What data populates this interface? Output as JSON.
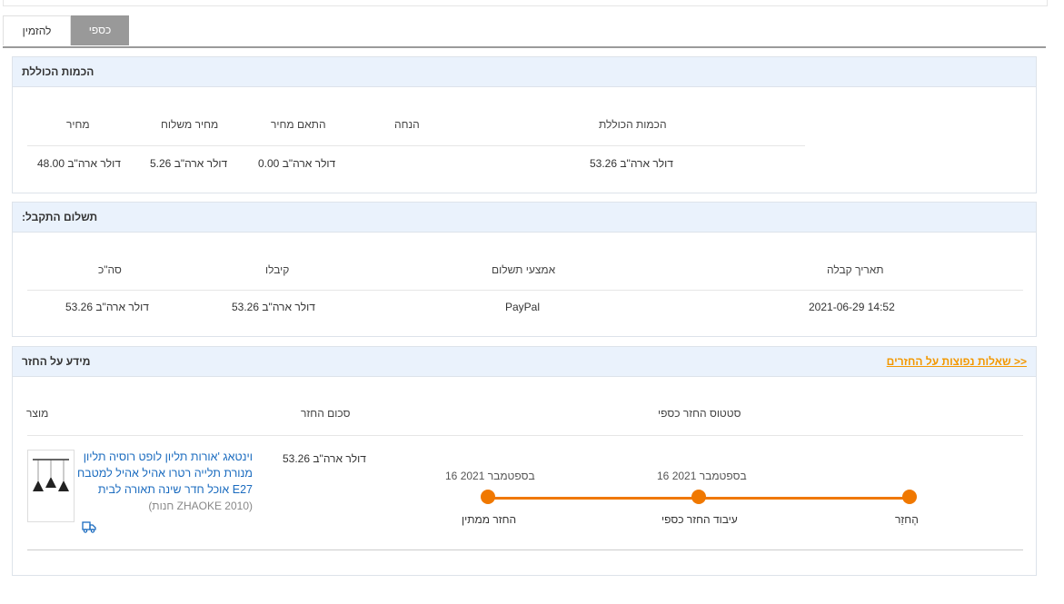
{
  "tabs": {
    "refund_label": "כספי",
    "order_label": "להזמין"
  },
  "totals": {
    "title": "הכמות הכוללת",
    "headers": {
      "price": "מחיר",
      "shipping": "מחיר משלוח",
      "adjust": "התאם מחיר",
      "discount": "הנחה",
      "total": "הכמות הכוללת"
    },
    "values": {
      "price": "48.00 דולר ארה\"ב",
      "shipping": "5.26 דולר ארה\"ב",
      "adjust": "0.00 דולר ארה\"ב",
      "discount": "",
      "total": "53.26 דולר ארה\"ב"
    }
  },
  "payment": {
    "title": "תשלום התקבל:",
    "headers": {
      "sum": "סה\"כ",
      "received": "קיבלו",
      "method": "אמצעי תשלום",
      "date": "תאריך קבלה"
    },
    "values": {
      "sum": "53.26 דולר ארה\"ב",
      "received": "53.26 דולר ארה\"ב",
      "method": "PayPal",
      "date": "2021-06-29 14:52"
    }
  },
  "refund": {
    "title": "מידע על החזר",
    "faq_link": "<< שאלות נפוצות על החזרים",
    "headers": {
      "product": "מוצר",
      "amount": "סכום החזר",
      "status": "סטטוס החזר כספי"
    },
    "product_title": "וינטאג 'אורות תליון לופט רוסיה תליון מנורת תלייה רטרו אהיל אהיל למטבח E27 אוכל חדר שינה תאורה לבית",
    "store": "(ZHAOKE 2010 חנות)",
    "amount": "53.26 דולר ארה\"ב",
    "steps": [
      {
        "label": "החזר ממתין",
        "date": "16 בספטמבר 2021"
      },
      {
        "label": "עיבוד החזר כספי",
        "date": "16 בספטמבר 2021"
      },
      {
        "label": "הֶחזֵר",
        "date": ""
      }
    ],
    "icons": {
      "truck": "truck-icon",
      "thumbnail": "pendant-lamp-thumbnail"
    },
    "accent_color": "#f07800",
    "link_color": "#f39800"
  }
}
